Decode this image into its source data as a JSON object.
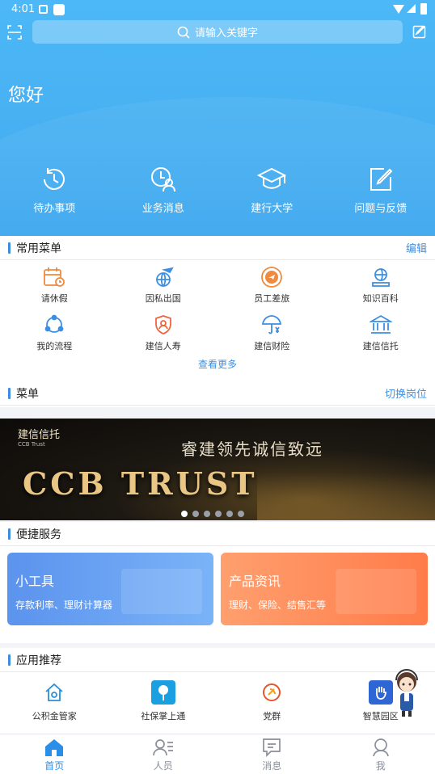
{
  "status_bar": {
    "time": "4:01"
  },
  "search": {
    "placeholder": "请输入关键字"
  },
  "greeting": "您好",
  "quick_actions": [
    {
      "label": "待办事项",
      "icon": "clock-back-icon"
    },
    {
      "label": "业务消息",
      "icon": "user-clock-icon"
    },
    {
      "label": "建行大学",
      "icon": "graduation-cap-icon"
    },
    {
      "label": "问题与反馈",
      "icon": "edit-note-icon"
    }
  ],
  "common_menu": {
    "title": "常用菜单",
    "action": "编辑",
    "items": [
      {
        "label": "请休假",
        "icon": "calendar-icon"
      },
      {
        "label": "因私出国",
        "icon": "globe-plane-icon"
      },
      {
        "label": "员工差旅",
        "icon": "plane-circle-icon"
      },
      {
        "label": "知识百科",
        "icon": "book-globe-icon"
      },
      {
        "label": "我的流程",
        "icon": "process-cycle-icon"
      },
      {
        "label": "建信人寿",
        "icon": "shield-person-icon"
      },
      {
        "label": "建信财险",
        "icon": "umbrella-yen-icon"
      },
      {
        "label": "建信信托",
        "icon": "bank-building-icon"
      }
    ],
    "more": "查看更多"
  },
  "menu": {
    "title": "菜单",
    "action": "切换岗位"
  },
  "banner": {
    "brand": "建信信托",
    "brand_sub": "CCB Trust",
    "slogan": "睿建领先诚信致远",
    "headline": "CCB TRUST",
    "dots": 6,
    "active_dot": 0
  },
  "convenient": {
    "title": "便捷服务",
    "cards": [
      {
        "title": "小工具",
        "subtitle": "存款利率、理财计算器"
      },
      {
        "title": "产品资讯",
        "subtitle": "理财、保险、结售汇等"
      }
    ]
  },
  "apps": {
    "title": "应用推荐",
    "items": [
      {
        "label": "公积金管家",
        "icon": "house-shield-icon"
      },
      {
        "label": "社保掌上通",
        "icon": "tree-icon"
      },
      {
        "label": "党群",
        "icon": "party-emblem-icon"
      },
      {
        "label": "智慧园区",
        "icon": "hand-icon"
      }
    ]
  },
  "tabbar": [
    {
      "label": "首页",
      "icon": "home-icon",
      "active": true
    },
    {
      "label": "人员",
      "icon": "contacts-icon",
      "active": false
    },
    {
      "label": "消息",
      "icon": "message-icon",
      "active": false
    },
    {
      "label": "我",
      "icon": "person-icon",
      "active": false
    }
  ],
  "colors": {
    "primary": "#3aa6ef",
    "accent": "#2b8fe8",
    "link": "#3d8fe2"
  }
}
